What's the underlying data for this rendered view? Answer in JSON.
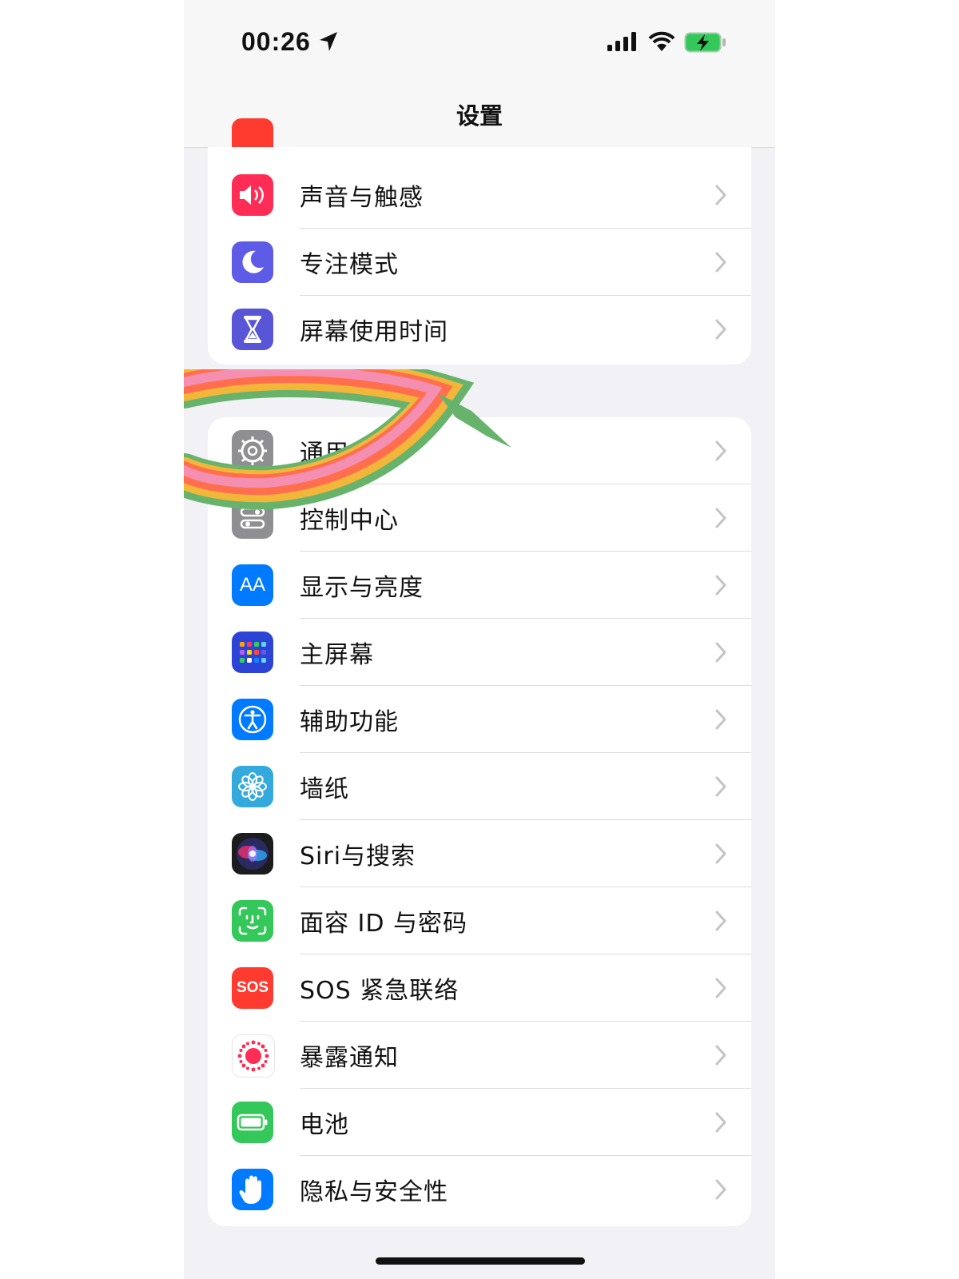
{
  "status": {
    "time": "00:26"
  },
  "nav": {
    "title": "设置"
  },
  "group1": [
    {
      "label": "声音与触感",
      "icon": "speaker-icon",
      "color": "#ff2d55"
    },
    {
      "label": "专注模式",
      "icon": "moon-icon",
      "color": "#5e5ce6"
    },
    {
      "label": "屏幕使用时间",
      "icon": "hourglass-icon",
      "color": "#5856d6"
    }
  ],
  "group2": [
    {
      "label": "通用",
      "icon": "gear-icon",
      "color": "#8e8e93"
    },
    {
      "label": "控制中心",
      "icon": "control-center-icon",
      "color": "#8e8e93"
    },
    {
      "label": "显示与亮度",
      "icon": "aa-icon",
      "color": "#007aff"
    },
    {
      "label": "主屏幕",
      "icon": "home-screen-icon",
      "color": "#2c44d6"
    },
    {
      "label": "辅助功能",
      "icon": "accessibility-icon",
      "color": "#007aff"
    },
    {
      "label": "墙纸",
      "icon": "flower-icon",
      "color": "#34aadc"
    },
    {
      "label": "Siri与搜索",
      "icon": "siri-icon",
      "color": "#222222"
    },
    {
      "label": "面容 ID 与密码",
      "icon": "face-id-icon",
      "color": "#34c759"
    },
    {
      "label": "SOS 紧急联络",
      "icon": "sos-icon",
      "color": "#ff3b30"
    },
    {
      "label": "暴露通知",
      "icon": "exposure-icon",
      "color": "#ffffff"
    },
    {
      "label": "电池",
      "icon": "battery-setting-icon",
      "color": "#34c759"
    },
    {
      "label": "隐私与安全性",
      "icon": "hand-icon",
      "color": "#007aff"
    }
  ],
  "icons": {
    "aa_text": "AA",
    "sos_text": "SOS"
  }
}
